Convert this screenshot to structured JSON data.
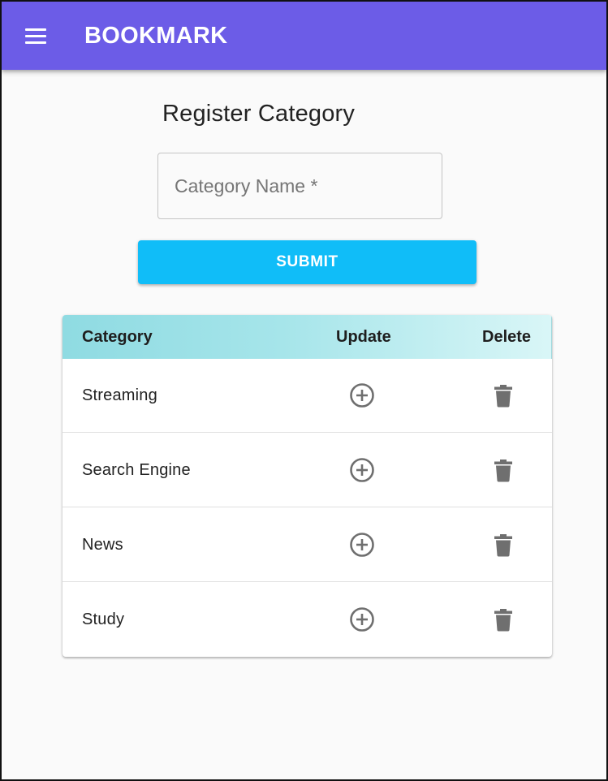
{
  "app": {
    "title": "BOOKMARK",
    "menu_icon": "hamburger-menu-icon",
    "appbar_color": "#6c5ce7"
  },
  "page": {
    "title": "Register Category"
  },
  "form": {
    "category_input": {
      "value": "",
      "placeholder": "Category Name *"
    },
    "submit_label": "SUBMIT",
    "submit_color": "#10bdf8"
  },
  "table": {
    "headers": {
      "category": "Category",
      "update": "Update",
      "delete": "Delete"
    },
    "update_icon": "add-circle-outline-icon",
    "delete_icon": "trash-icon",
    "rows": [
      {
        "category": "Streaming"
      },
      {
        "category": "Search Engine"
      },
      {
        "category": "News"
      },
      {
        "category": "Study"
      }
    ]
  }
}
